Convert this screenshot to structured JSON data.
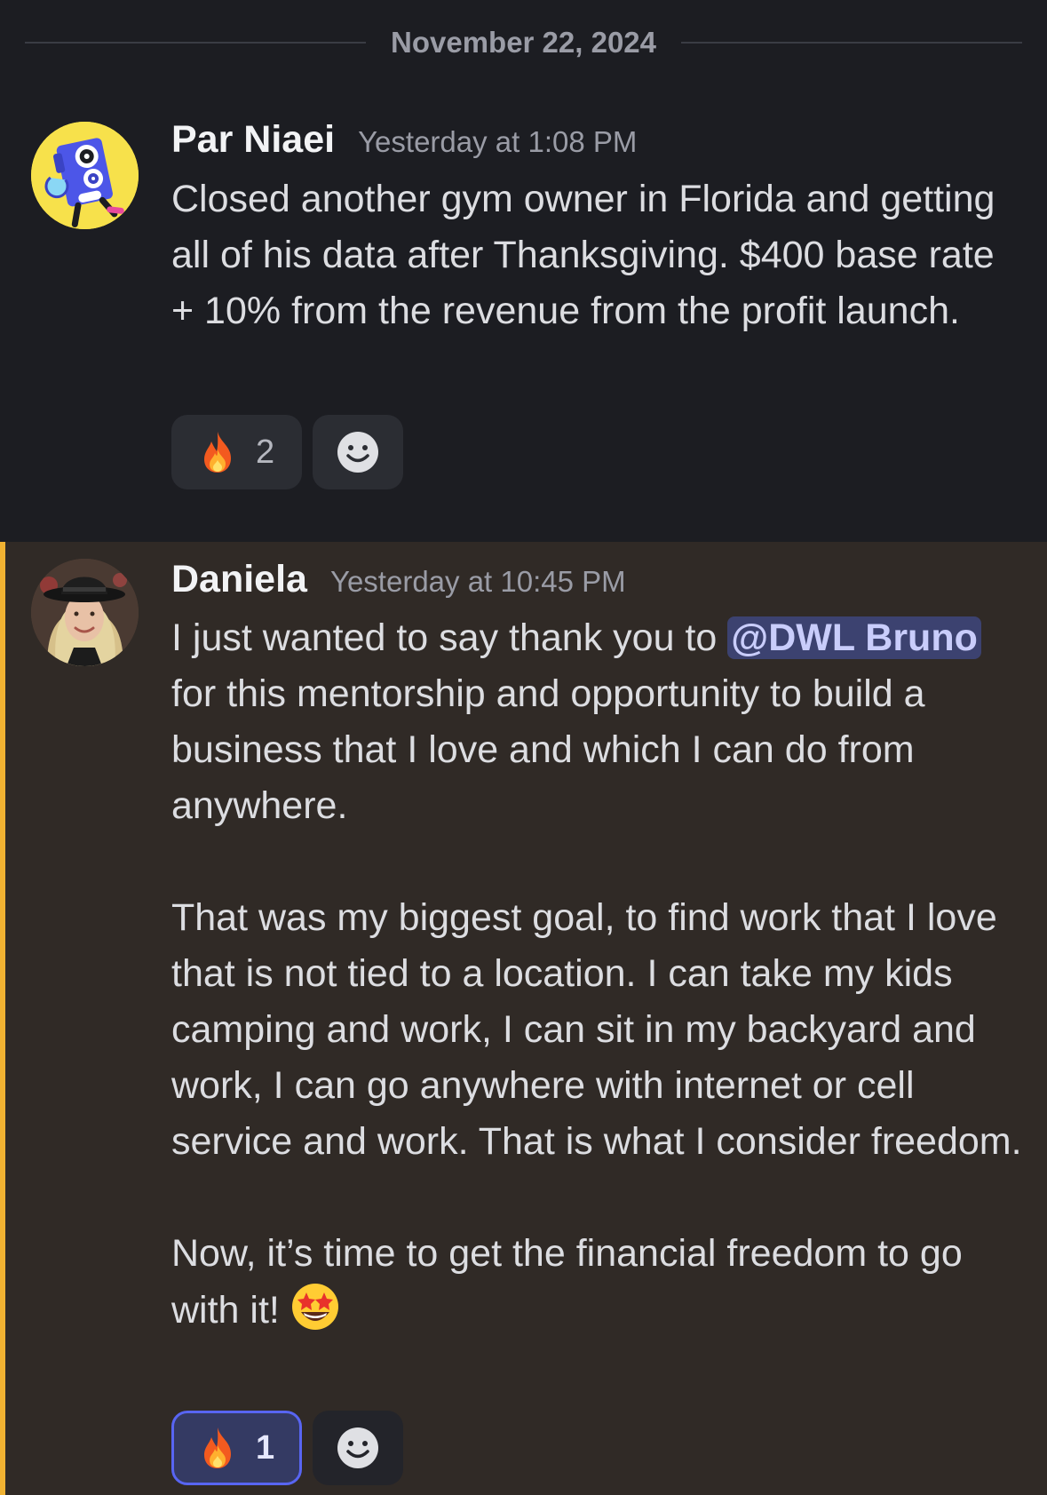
{
  "date_divider": "November 22, 2024",
  "messages": [
    {
      "username": "Par Niaei",
      "timestamp": "Yesterday at 1:08 PM",
      "paragraphs": [
        "Closed another gym owner in Florida and getting all of his data after Thanksgiving. $400 base rate + 10% from the revenue from the profit launch."
      ],
      "reaction": {
        "icon": "fire-icon",
        "count": "2"
      }
    },
    {
      "username": "Daniela",
      "timestamp": "Yesterday at 10:45 PM",
      "intro": "I just wanted to say thank you to ",
      "mention": "@DWL Bruno",
      "intro_rest": " for this mentorship and opportunity to build a business that I love and which I can do from anywhere.",
      "paragraph2": "That was my biggest goal, to find work that I love that is not tied to a location. I can take my kids camping and work, I can sit in my backyard and work, I can go anywhere with internet or cell service and work. That is what I consider freedom.",
      "paragraph3": "Now, it’s time to get the financial freedom to go with it! ",
      "reaction": {
        "icon": "fire-icon",
        "count": "1"
      }
    }
  ],
  "colors": {
    "background": "#1c1d22",
    "highlight_background": "#302a26",
    "highlight_bar": "#f0b232",
    "mention_bg": "#3c4270",
    "active_reaction_border": "#5865f2"
  }
}
